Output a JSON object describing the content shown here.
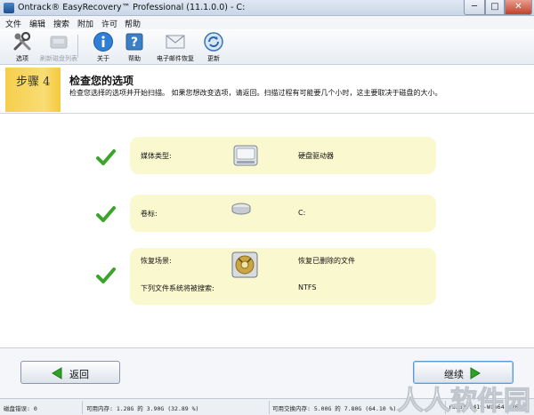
{
  "window": {
    "title": "Ontrack® EasyRecovery™ Professional (11.1.0.0) - C:",
    "minimize_symbol": "─",
    "maximize_symbol": "□",
    "close_symbol": "✕"
  },
  "menu": [
    "文件",
    "编辑",
    "搜索",
    "附加",
    "许可",
    "帮助"
  ],
  "toolbar": {
    "items": [
      {
        "label": "选项",
        "icon": "tools-icon",
        "enabled": true
      },
      {
        "label": "刷新磁盘列表",
        "icon": "refresh-disk-list-icon",
        "enabled": false
      },
      {
        "label": "关于",
        "icon": "info-icon",
        "enabled": true
      },
      {
        "label": "帮助",
        "icon": "help-icon",
        "enabled": true
      },
      {
        "label": "电子邮件恢复",
        "icon": "envelope-icon",
        "enabled": true
      },
      {
        "label": "更新",
        "icon": "update-icon",
        "enabled": true
      }
    ]
  },
  "step": {
    "badge": "步骤 4",
    "title": "检查您的选项",
    "description": "检查您选择的选项并开始扫描。 如果您想改变选项，请返回。扫描过程有可能要几个小时，这主要取决于磁盘的大小。"
  },
  "options": [
    {
      "label": "媒体类型:",
      "value": "硬盘驱动器",
      "icon": "hard-drive-icon"
    },
    {
      "label": "卷标:",
      "value": "C:",
      "icon": "volume-icon"
    },
    {
      "label": "恢复场景:",
      "value": "恢复已删除的文件",
      "icon": "recovery-scenario-icon",
      "extra_label": "下列文件系统将被搜索:",
      "extra_value": "NTFS"
    }
  ],
  "buttons": {
    "back": "返回",
    "next": "继续"
  },
  "status": {
    "disk_errors": "磁盘错误: 0",
    "memory": "可用内存: 1.28G 的 3.90G (32.89 %)",
    "swap": "可用交换内存: 5.00G 的 7.80G (64.10 %)",
    "build": "r8363:8419-Win64",
    "code": "709"
  },
  "watermark": "人人软件园",
  "colors": {
    "step_badge": "#f5ce4d",
    "card_bg": "#faf8cf",
    "check_green": "#3aa52a",
    "back_arrow_green": "#2fa128"
  }
}
